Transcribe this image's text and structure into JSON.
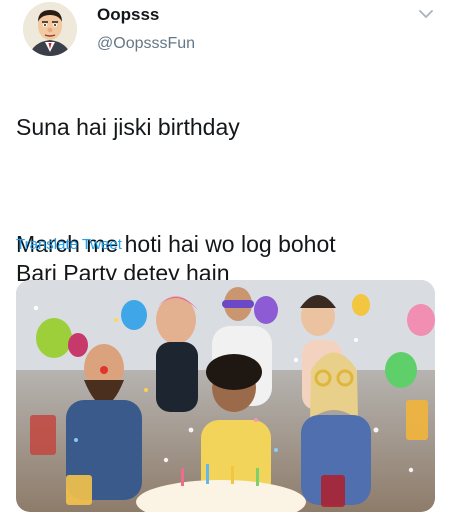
{
  "user": {
    "display_name": "Oopsss",
    "handle": "@OopsssFun",
    "avatar_icon": "cartoon-man-avatar"
  },
  "tweet": {
    "line1": "Suna hai jiski birthday",
    "line2": "March me hoti hai wo log bohot\nBari Party detey hain",
    "translate_label": "Translate Tweet"
  },
  "media": {
    "description_icon": "party-photo"
  },
  "colors": {
    "accent": "#1da1f2",
    "text": "#14171a",
    "muted": "#657786"
  }
}
